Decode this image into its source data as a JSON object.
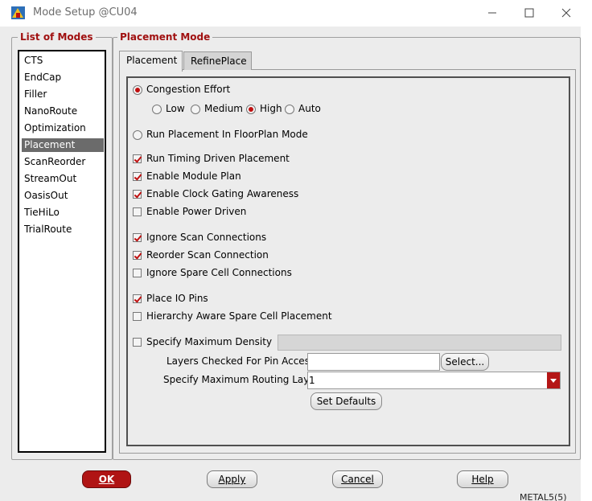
{
  "window": {
    "title": "Mode Setup @CU04",
    "minimize_icon": "minimize-icon",
    "maximize_icon": "maximize-icon",
    "close_icon": "close-icon"
  },
  "modes_group": {
    "label": "List of Modes",
    "items": [
      "CTS",
      "EndCap",
      "Filler",
      "NanoRoute",
      "Optimization",
      "Placement",
      "ScanReorder",
      "StreamOut",
      "OasisOut",
      "TieHiLo",
      "TrialRoute"
    ],
    "selected": "Placement"
  },
  "placement_group": {
    "label": "Placement Mode",
    "tabs": [
      "Placement",
      "RefinePlace"
    ],
    "active_tab": "Placement"
  },
  "options": {
    "congestion_effort": {
      "label": "Congestion Effort",
      "selected": true
    },
    "effort_levels": [
      {
        "label": "Low",
        "selected": false
      },
      {
        "label": "Medium",
        "selected": false
      },
      {
        "label": "High",
        "selected": true
      },
      {
        "label": "Auto",
        "selected": false
      }
    ],
    "run_floorplan": {
      "label": "Run Placement In FloorPlan Mode",
      "selected": false
    },
    "run_timing_driven": {
      "label": "Run Timing Driven Placement",
      "checked": true
    },
    "enable_module_plan": {
      "label": "Enable Module Plan",
      "checked": true
    },
    "enable_clock_gating": {
      "label": "Enable Clock Gating Awareness",
      "checked": true
    },
    "enable_power_driven": {
      "label": "Enable Power Driven",
      "checked": false
    },
    "ignore_scan": {
      "label": "Ignore Scan Connections",
      "checked": true
    },
    "reorder_scan": {
      "label": "Reorder Scan Connection",
      "checked": true
    },
    "ignore_spare": {
      "label": "Ignore Spare Cell Connections",
      "checked": false
    },
    "place_io_pins": {
      "label": "Place IO Pins",
      "checked": true
    },
    "hierarchy_spare": {
      "label": "Hierarchy Aware Spare Cell Placement",
      "checked": false
    },
    "max_density": {
      "label": "Specify Maximum Density",
      "checked": false,
      "value": ""
    },
    "layers_pin_access": {
      "label": "Layers Checked For Pin Access",
      "value": "",
      "button": "Select..."
    },
    "max_routing_layer": {
      "label": "Specify Maximum Routing Layer",
      "value": "1"
    },
    "set_defaults": "Set Defaults"
  },
  "dialog_buttons": {
    "ok": "OK",
    "apply": "Apply",
    "cancel": "Cancel",
    "help": "Help"
  },
  "background_text": "METAL5(5)",
  "colors": {
    "accent_red": "#b01414",
    "group_label_red": "#a01010",
    "selection_gray": "#6b6b6b"
  }
}
